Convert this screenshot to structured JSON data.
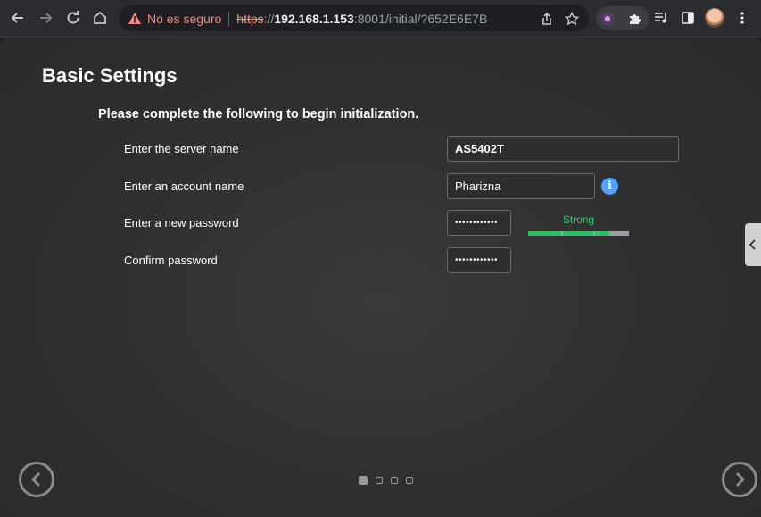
{
  "browser": {
    "security_label": "No es seguro",
    "url_scheme": "https",
    "url_host": "192.168.1.153",
    "url_rest": ":8001/initial/?652E6E7B"
  },
  "page": {
    "title": "Basic Settings",
    "subtitle": "Please complete the following to begin initialization.",
    "fields": {
      "server_name_label": "Enter the server name",
      "server_name_value": "AS5402T",
      "account_name_label": "Enter an account name",
      "account_name_value": "Pharizna",
      "password_label": "Enter a new password",
      "password_value": "••••••••••••",
      "confirm_label": "Confirm password",
      "confirm_value": "••••••••••••"
    },
    "password_strength": {
      "label": "Strong",
      "level_fraction": 0.8
    },
    "pagination": {
      "total": 4,
      "current": 1
    }
  },
  "colors": {
    "strength": "#22c55e",
    "info": "#4da3ff",
    "warning": "#f28b82"
  }
}
